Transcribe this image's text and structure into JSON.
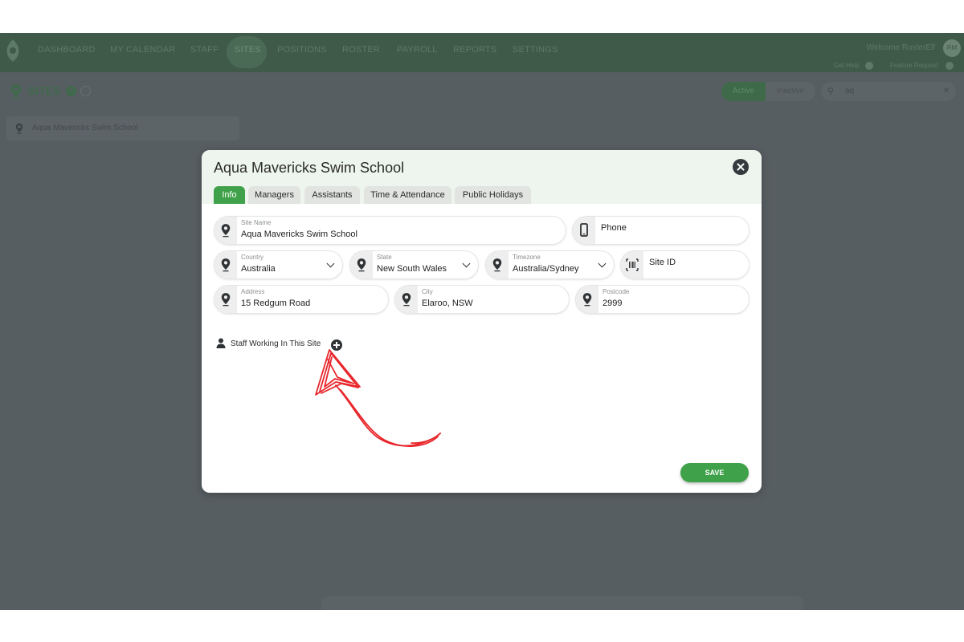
{
  "topnav": {
    "items": [
      "DASHBOARD",
      "MY CALENDAR",
      "STAFF",
      "SITES",
      "POSITIONS",
      "ROSTER",
      "PAYROLL",
      "REPORTS",
      "SETTINGS"
    ],
    "welcome": "Welcome RosterElf",
    "avatar": "RM",
    "get_help": "Get Help",
    "feature_request": "Feature Request"
  },
  "sites_header": {
    "title": "SITES",
    "toggle_active": "Active",
    "toggle_inactive": "Inactive",
    "search_value": "aq"
  },
  "site_list": [
    {
      "name": "Aqua Mavericks Swim School"
    }
  ],
  "modal": {
    "title": "Aqua Mavericks Swim School",
    "tabs": [
      "Info",
      "Managers",
      "Assistants",
      "Time & Attendance",
      "Public Holidays"
    ],
    "active_tab": "Info",
    "fields": {
      "site_name": {
        "label": "Site Name",
        "value": "Aqua Mavericks Swim School"
      },
      "phone": {
        "placeholder": "Phone"
      },
      "country": {
        "label": "Country",
        "value": "Australia"
      },
      "state": {
        "label": "State",
        "value": "New South Wales"
      },
      "timezone": {
        "label": "Timezone",
        "value": "Australia/Sydney"
      },
      "site_id": {
        "placeholder": "Site ID"
      },
      "address": {
        "label": "Address",
        "value": "15 Redgum Road"
      },
      "city": {
        "label": "City",
        "value": "Elaroo, NSW"
      },
      "postcode": {
        "label": "Postcode",
        "value": "2999"
      }
    },
    "staff_section_label": "Staff Working In This Site",
    "save_label": "SAVE"
  },
  "colors": {
    "accent_green": "#3fa149",
    "overlay": "#575e62",
    "annotation_red": "#e8262b"
  },
  "icons": [
    "map-pin-icon",
    "phone-icon",
    "barcode-icon",
    "person-icon",
    "plus-circle-icon",
    "close-icon",
    "chevron-down-icon",
    "search-icon"
  ]
}
